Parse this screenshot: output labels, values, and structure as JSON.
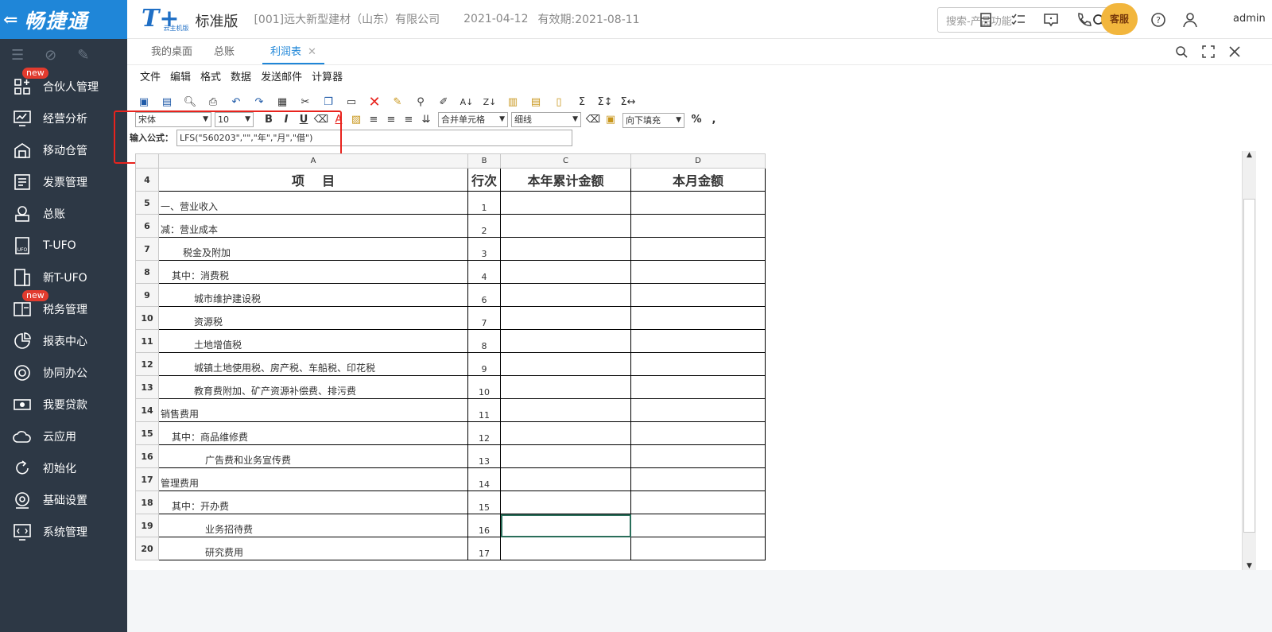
{
  "sidebar": {
    "logo": "畅捷通",
    "items": [
      {
        "label": "合伙人管理",
        "badge": "new",
        "icon": "partner-icon"
      },
      {
        "label": "经营分析",
        "badge": "",
        "icon": "analysis-icon"
      },
      {
        "label": "移动仓管",
        "badge": "",
        "icon": "warehouse-icon"
      },
      {
        "label": "发票管理",
        "badge": "",
        "icon": "invoice-icon"
      },
      {
        "label": "总账",
        "badge": "",
        "icon": "ledger-icon"
      },
      {
        "label": "T-UFO",
        "badge": "",
        "icon": "ufo-icon"
      },
      {
        "label": "新T-UFO",
        "badge": "",
        "icon": "new-ufo-icon"
      },
      {
        "label": "税务管理",
        "badge": "new",
        "icon": "tax-icon"
      },
      {
        "label": "报表中心",
        "badge": "",
        "icon": "report-icon"
      },
      {
        "label": "协同办公",
        "badge": "",
        "icon": "office-icon"
      },
      {
        "label": "我要贷款",
        "badge": "",
        "icon": "loan-icon"
      },
      {
        "label": "云应用",
        "badge": "",
        "icon": "cloud-icon"
      },
      {
        "label": "初始化",
        "badge": "",
        "icon": "init-icon"
      },
      {
        "label": "基础设置",
        "badge": "",
        "icon": "settings-icon"
      },
      {
        "label": "系统管理",
        "badge": "",
        "icon": "system-icon"
      }
    ]
  },
  "header": {
    "brand": "T+",
    "brand_sub": "云主机版",
    "edition": "标准版",
    "company": "[001]远大新型建材（山东）有限公司",
    "date": "2021-04-12",
    "validity": "有效期:2021-08-11",
    "search_placeholder": "搜索-产品功能",
    "service_badge": "客服",
    "user": "admin"
  },
  "tabs": [
    {
      "label": "我的桌面",
      "active": false
    },
    {
      "label": "总账",
      "active": false
    },
    {
      "label": "利润表",
      "active": true
    }
  ],
  "menu": [
    "文件",
    "编辑",
    "格式",
    "数据",
    "发送邮件",
    "计算器"
  ],
  "format": {
    "font": "宋体",
    "size": "10",
    "merge": "合并单元格",
    "border": "细线",
    "fill": "向下填充",
    "percent": "%",
    "comma": ","
  },
  "formula": {
    "label": "输入公式：",
    "value": "LFS(\"560203\",\"\",\"年\",\"月\",\"借\")"
  },
  "sheet": {
    "columns": [
      "A",
      "B",
      "C",
      "D"
    ],
    "header_row": {
      "row": "4",
      "a": "项    目",
      "b": "行次",
      "c": "本年累计金额",
      "d": "本月金额"
    },
    "rows": [
      {
        "row": "5",
        "item": "一、营业收入",
        "indent": 0,
        "line": "1"
      },
      {
        "row": "6",
        "item": "减：营业成本",
        "indent": 0,
        "line": "2"
      },
      {
        "row": "7",
        "item": "税金及附加",
        "indent": 2,
        "line": "3"
      },
      {
        "row": "8",
        "item": "其中：消费税",
        "indent": 1,
        "line": "4"
      },
      {
        "row": "9",
        "item": "城市维护建设税",
        "indent": 3,
        "line": "6"
      },
      {
        "row": "10",
        "item": "资源税",
        "indent": 3,
        "line": "7"
      },
      {
        "row": "11",
        "item": "土地增值税",
        "indent": 3,
        "line": "8"
      },
      {
        "row": "12",
        "item": "城镇土地使用税、房产税、车船税、印花税",
        "indent": 3,
        "line": "9"
      },
      {
        "row": "13",
        "item": "教育费附加、矿产资源补偿费、排污费",
        "indent": 3,
        "line": "10"
      },
      {
        "row": "14",
        "item": "销售费用",
        "indent": 0,
        "line": "11"
      },
      {
        "row": "15",
        "item": "其中：商品维修费",
        "indent": 1,
        "line": "12"
      },
      {
        "row": "16",
        "item": "广告费和业务宣传费",
        "indent": 4,
        "line": "13"
      },
      {
        "row": "17",
        "item": "管理费用",
        "indent": 0,
        "line": "14"
      },
      {
        "row": "18",
        "item": "其中：开办费",
        "indent": 1,
        "line": "15"
      },
      {
        "row": "19",
        "item": "业务招待费",
        "indent": 4,
        "line": "16"
      },
      {
        "row": "20",
        "item": "研究费用",
        "indent": 4,
        "line": "17"
      }
    ],
    "selected_row": "19"
  }
}
